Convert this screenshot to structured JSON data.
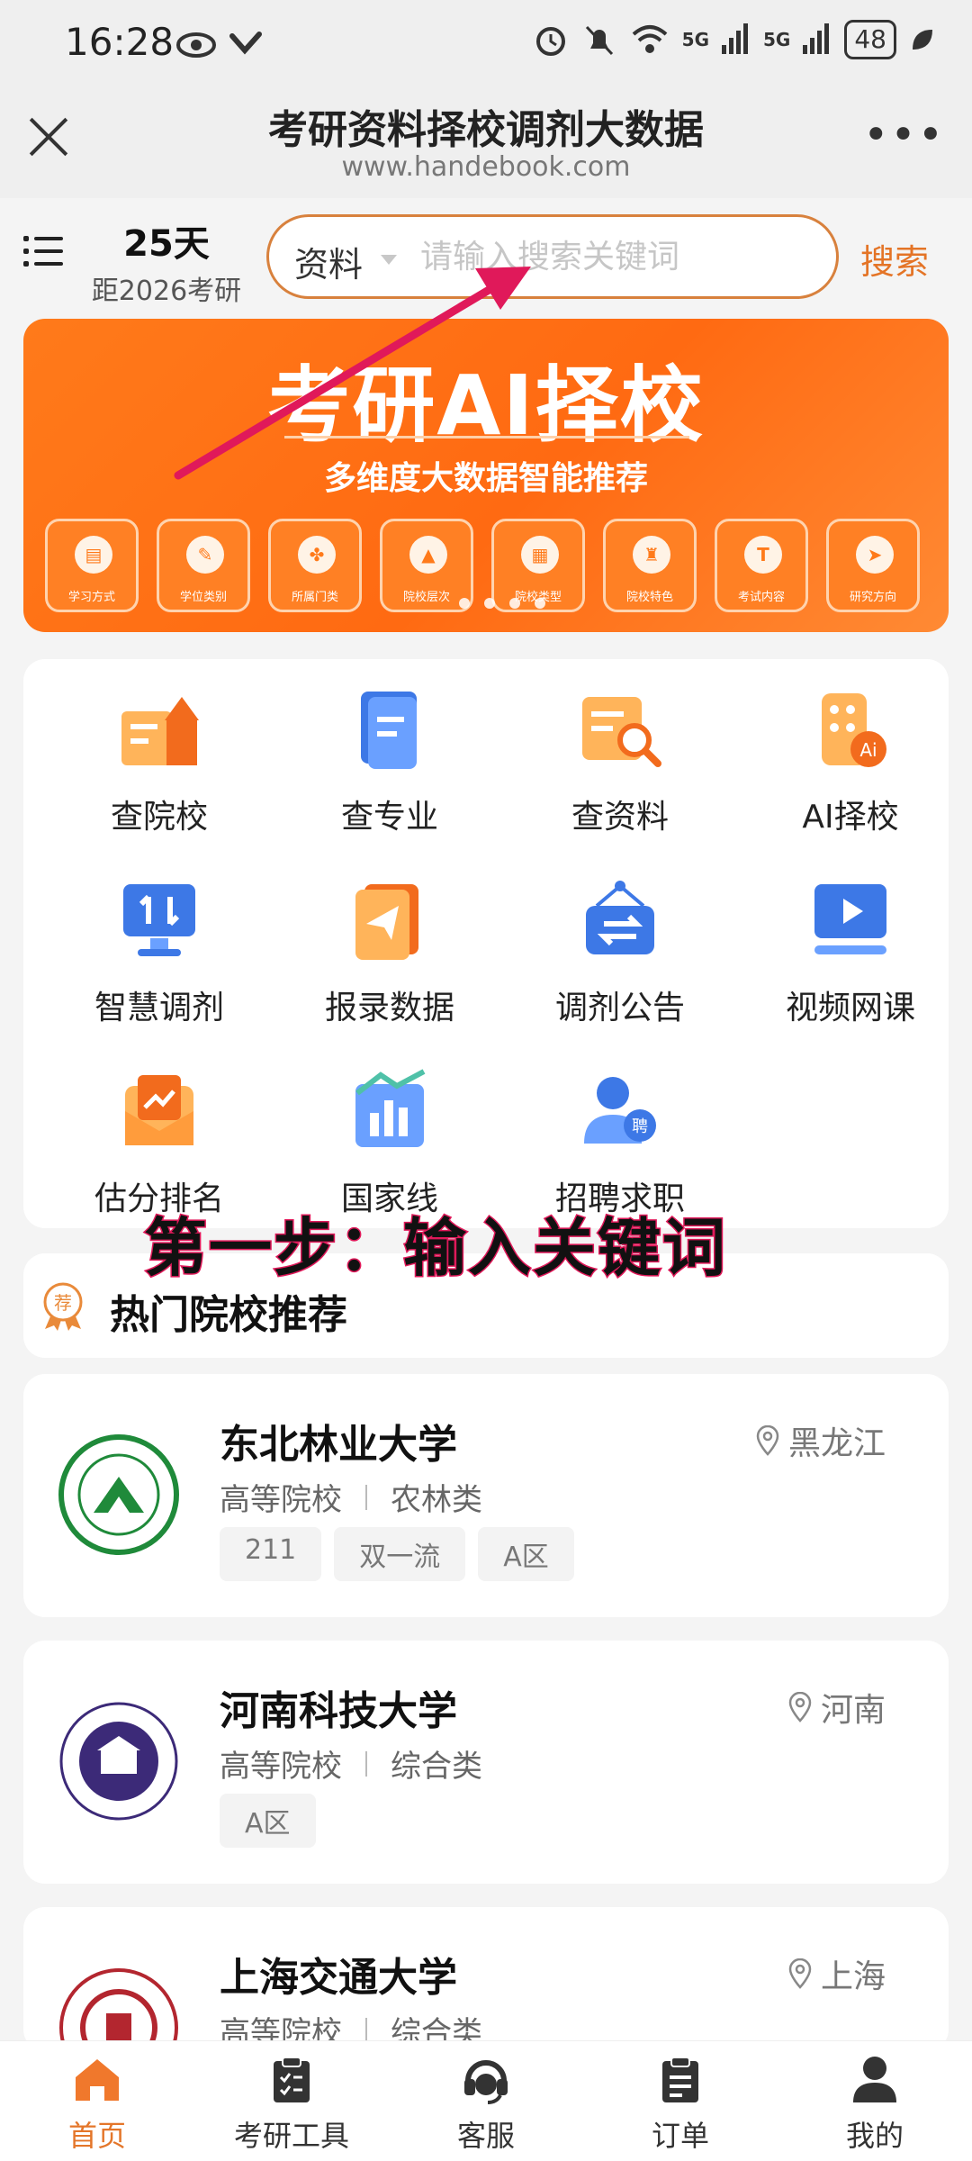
{
  "status_bar": {
    "time": "16:28",
    "signal1": "5G",
    "signal2": "5G",
    "battery": "48"
  },
  "titlebar": {
    "title": "考研资料择校调剂大数据",
    "subtitle": "www.handebook.com",
    "more": "•••"
  },
  "search": {
    "days": "25天",
    "countdown_label": "距2026考研",
    "category": "资料",
    "placeholder": "请输入搜索关键词",
    "button": "搜索"
  },
  "banner": {
    "title": "考研AI择校",
    "subtitle": "多维度大数据智能推荐",
    "features": [
      {
        "label": "学习方式",
        "glyph": "▤"
      },
      {
        "label": "学位类别",
        "glyph": "✎"
      },
      {
        "label": "所属门类",
        "glyph": "✤"
      },
      {
        "label": "院校层次",
        "glyph": "▲"
      },
      {
        "label": "院校类型",
        "glyph": "▦"
      },
      {
        "label": "院校特色",
        "glyph": "♜"
      },
      {
        "label": "考试内容",
        "glyph": "T"
      },
      {
        "label": "研究方向",
        "glyph": "➤"
      }
    ]
  },
  "grid": [
    {
      "label": "查院校",
      "icon": "school-building-icon"
    },
    {
      "label": "查专业",
      "icon": "book-icon"
    },
    {
      "label": "查资料",
      "icon": "document-search-icon"
    },
    {
      "label": "AI择校",
      "icon": "ai-building-icon"
    },
    {
      "label": "智慧调剂",
      "icon": "monitor-transfer-icon"
    },
    {
      "label": "报录数据",
      "icon": "paper-plane-icon"
    },
    {
      "label": "调剂公告",
      "icon": "notice-sign-icon"
    },
    {
      "label": "视频网课",
      "icon": "video-play-icon"
    },
    {
      "label": "估分排名",
      "icon": "envelope-chart-icon"
    },
    {
      "label": "国家线",
      "icon": "bar-chart-icon"
    },
    {
      "label": "招聘求职",
      "icon": "recruit-user-icon"
    }
  ],
  "annotation": "第一步：输入关键词",
  "hot": {
    "badge": "荐",
    "title": "热门院校推荐"
  },
  "schools": [
    {
      "name": "东北林业大学",
      "location": "黑龙江",
      "kind": "高等院校",
      "category": "农林类",
      "tags": [
        "211",
        "双一流",
        "A区"
      ],
      "logo_color": "#1f8a3a"
    },
    {
      "name": "河南科技大学",
      "location": "河南",
      "kind": "高等院校",
      "category": "综合类",
      "tags": [
        "A区"
      ],
      "logo_color": "#3c2a78"
    },
    {
      "name": "上海交通大学",
      "location": "上海",
      "kind": "高等院校",
      "category": "综合类",
      "tags": [],
      "logo_color": "#b3262f"
    }
  ],
  "tabs": [
    {
      "label": "首页",
      "icon": "home-icon"
    },
    {
      "label": "考研工具",
      "icon": "clipboard-icon"
    },
    {
      "label": "客服",
      "icon": "headset-icon"
    },
    {
      "label": "订单",
      "icon": "order-icon"
    },
    {
      "label": "我的",
      "icon": "user-icon"
    }
  ],
  "colors": {
    "accent": "#e47426",
    "banner": "#ff7a1a",
    "annotation_stroke": "#e0195a",
    "arrow": "#e0195a"
  }
}
